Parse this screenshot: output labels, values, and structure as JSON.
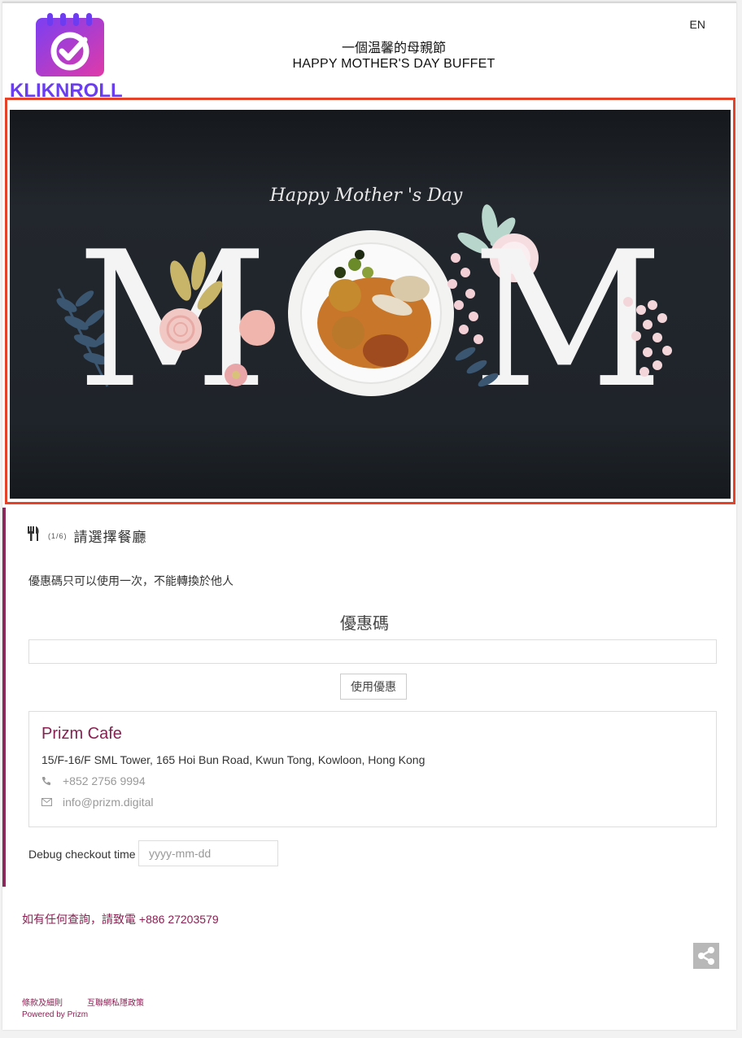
{
  "header": {
    "logo_text": "KLIKNROLL",
    "lang_label": "EN",
    "title_zh": "一個温馨的母親節",
    "title_en": "HAPPY MOTHER'S DAY BUFFET"
  },
  "banner": {
    "script_text": "Happy Mother 's Day",
    "letter_left": "M",
    "letter_right": "M"
  },
  "step": {
    "icon": "utensils-icon",
    "count": "(1/6)",
    "title": "請選擇餐廳"
  },
  "notice": "優惠碼只可以使用一次，不能轉換於他人",
  "coupon": {
    "label": "優惠碼",
    "value": "",
    "button_label": "使用優惠"
  },
  "restaurant": {
    "name": "Prizm Cafe",
    "address": "15/F-16/F SML Tower, 165 Hoi Bun Road, Kwun Tong, Kowloon, Hong Kong",
    "phone": "+852 2756 9994",
    "email": "info@prizm.digital"
  },
  "debug": {
    "label": "Debug checkout time",
    "placeholder": "yyyy-mm-dd"
  },
  "enquiry": "如有任何查詢，請致電 +886 27203579",
  "footer": {
    "terms": "條款及細則",
    "privacy": "互聯網私隱政策",
    "powered_by": "Powered by Prizm"
  },
  "colors": {
    "brand": "#8a1f52",
    "highlight_border": "#e4432a",
    "banner_bg": "#1f242a"
  }
}
